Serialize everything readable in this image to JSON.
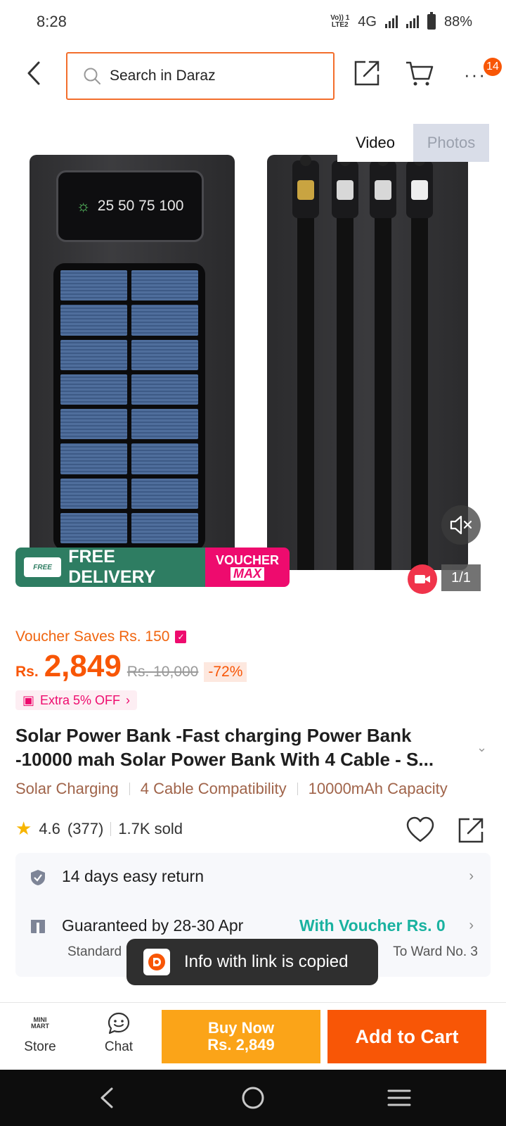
{
  "status_bar": {
    "time": "8:28",
    "volte": "Vo)) 1",
    "lte": "LTE2",
    "network": "4G",
    "battery": "88%"
  },
  "header": {
    "search_placeholder": "Search in Daraz",
    "cart_badge": "14",
    "more_label": "···"
  },
  "media": {
    "tabs": [
      {
        "label": "Video",
        "active": true
      },
      {
        "label": "Photos",
        "active": false
      }
    ],
    "screen_readout": "25 50 75 100",
    "promo_free_badge": "FREE",
    "promo_free_delivery": "FREE DELIVERY",
    "promo_voucher_line1": "VOUCHER",
    "promo_voucher_line2": "MAX",
    "counter": "1/1"
  },
  "product": {
    "voucher_saves": "Voucher Saves Rs. 150",
    "currency": "Rs.",
    "price": "2,849",
    "old_price": "Rs. 10,000",
    "discount": "-72%",
    "extra_off": "Extra 5% OFF",
    "title": "Solar Power Bank -Fast charging Power Bank -10000 mah Solar Power Bank With 4 Cable - S...",
    "features": [
      "Solar Charging",
      "4 Cable Compatibility",
      "10000mAh Capacity"
    ],
    "rating": "4.6",
    "reviews": "(377)",
    "sold": "1.7K sold"
  },
  "services": {
    "return": "14 days easy return",
    "delivery": "Guaranteed by 28-30 Apr",
    "voucher": "With Voucher Rs. 0",
    "sub_left": "Standard Delivery",
    "sub_right": "To Ward No. 3"
  },
  "toast": {
    "message": "Info with link is copied"
  },
  "bottom_bar": {
    "store_logo": "MINI MART",
    "store_label": "Store",
    "chat_label": "Chat",
    "buy_now_label": "Buy Now",
    "buy_now_price": "Rs. 2,849",
    "add_to_cart_label": "Add to Cart"
  },
  "colors": {
    "brand_orange": "#f85606",
    "buy_now_yellow": "#fba418",
    "voucher_pink": "#ee0b6e",
    "delivery_green": "#2e7d62",
    "voucher_teal": "#1ab2a0"
  }
}
